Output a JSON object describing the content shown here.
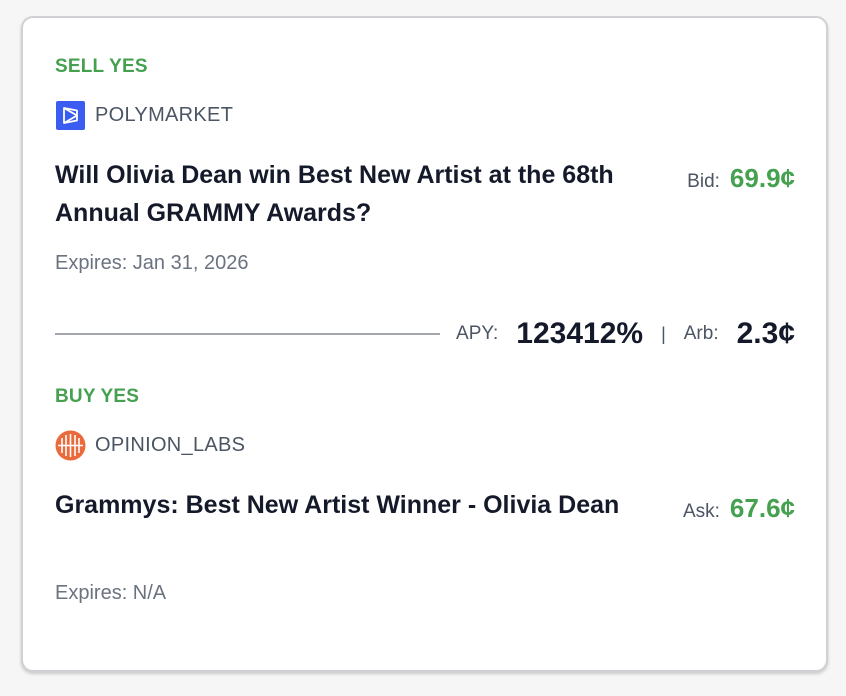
{
  "sell": {
    "label": "SELL YES",
    "venue": "POLYMARKET",
    "venue_icon": "polymarket-logo",
    "venue_color": "#3b5cf0",
    "title": "Will Olivia Dean win Best New Artist at the 68th Annual GRAMMY Awards?",
    "expires": "Expires: Jan 31, 2026",
    "price_label": "Bid:",
    "price_value": "69.9¢"
  },
  "metrics": {
    "apy_label": "APY:",
    "apy_value": "123412%",
    "separator": "|",
    "arb_label": "Arb:",
    "arb_value": "2.3¢"
  },
  "buy": {
    "label": "BUY YES",
    "venue": "OPINION_LABS",
    "venue_icon": "opinion-labs-logo",
    "venue_color": "#ea6a3b",
    "title": "Grammys: Best New Artist Winner - Olivia Dean",
    "expires": "Expires: N/A",
    "price_label": "Ask:",
    "price_value": "67.6¢"
  },
  "colors": {
    "accent_green": "#45a14f",
    "title_text": "#151a2b",
    "muted_text": "#6b7280"
  }
}
